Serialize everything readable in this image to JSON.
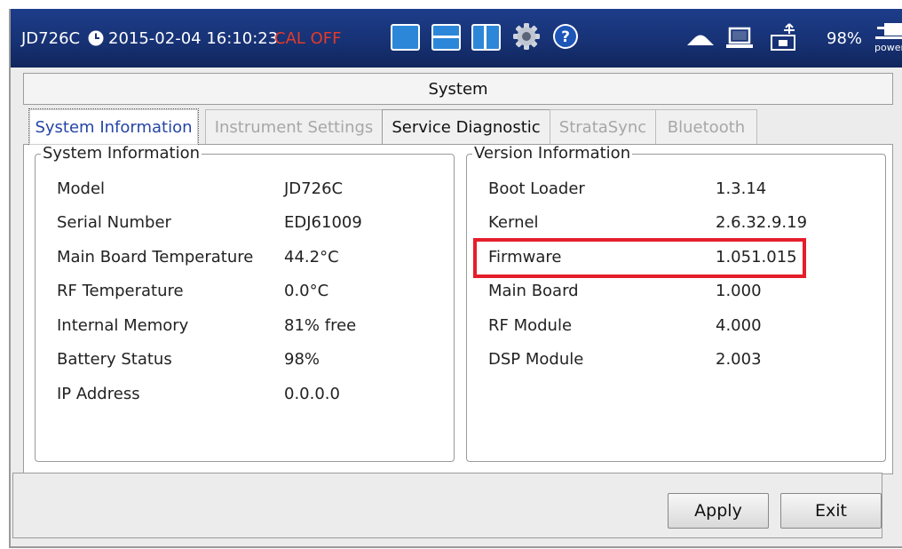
{
  "statusbar": {
    "model": "JD726C",
    "datetime": "2015-02-04 16:10:23",
    "cal_status": "CAL OFF",
    "battery": "98%",
    "power_label": "power"
  },
  "window": {
    "title": "System"
  },
  "tabs": [
    {
      "label": "System Information",
      "state": "active"
    },
    {
      "label": "Instrument Settings",
      "state": "disabled"
    },
    {
      "label": "Service Diagnostic",
      "state": "enabled"
    },
    {
      "label": "StrataSync",
      "state": "disabled"
    },
    {
      "label": "Bluetooth",
      "state": "disabled"
    }
  ],
  "system_info": {
    "title": "System Information",
    "rows": [
      {
        "label": "Model",
        "value": "JD726C"
      },
      {
        "label": "Serial Number",
        "value": "EDJ61009"
      },
      {
        "label": "Main Board Temperature",
        "value": "44.2°C"
      },
      {
        "label": "RF Temperature",
        "value": "0.0°C"
      },
      {
        "label": "Internal Memory",
        "value": "81% free"
      },
      {
        "label": "Battery Status",
        "value": "98%"
      },
      {
        "label": "IP Address",
        "value": "0.0.0.0"
      }
    ]
  },
  "version_info": {
    "title": "Version Information",
    "rows": [
      {
        "label": "Boot Loader",
        "value": "1.3.14"
      },
      {
        "label": "Kernel",
        "value": "2.6.32.9.19"
      },
      {
        "label": "Firmware",
        "value": "1.051.015"
      },
      {
        "label": "Main Board",
        "value": "1.000"
      },
      {
        "label": "RF Module",
        "value": "4.000"
      },
      {
        "label": "DSP Module",
        "value": "2.003"
      }
    ]
  },
  "buttons": {
    "apply": "Apply",
    "exit": "Exit"
  },
  "colors": {
    "statusbar": "#173275",
    "cal_off": "#e33a2a",
    "highlight": "#e51e2a",
    "active_tab_text": "#2545a6"
  },
  "icons": [
    "clock-icon",
    "single-view-icon",
    "split-horizontal-icon",
    "split-vertical-icon",
    "gear-icon",
    "help-icon",
    "cloud-icon",
    "laptop-icon",
    "usb-icon",
    "power-icon"
  ]
}
